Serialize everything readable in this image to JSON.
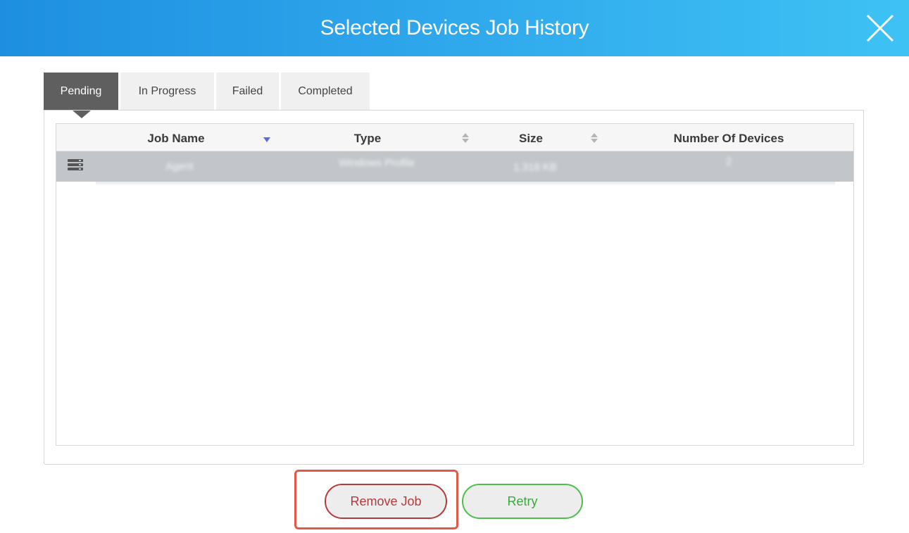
{
  "dialog": {
    "title": "Selected Devices Job History",
    "close_icon": "close-icon"
  },
  "tabs": [
    {
      "label": "Pending",
      "active": true
    },
    {
      "label": "In Progress",
      "active": false
    },
    {
      "label": "Failed",
      "active": false
    },
    {
      "label": "Completed",
      "active": false
    }
  ],
  "table": {
    "columns": [
      "Job Name",
      "Type",
      "Size",
      "Number Of Devices"
    ],
    "sort": {
      "column": "Job Name",
      "direction": "descending"
    },
    "rows": [
      {
        "icon": "server-icon",
        "job_name": "Agent",
        "type": "Windows Profile",
        "size": "1.318 KB",
        "devices": "2",
        "selected": true
      }
    ]
  },
  "actions": {
    "remove_label": "Remove Job",
    "retry_label": "Retry"
  },
  "colors": {
    "header_gradient_start": "#1e8fe0",
    "header_gradient_end": "#3ec2f4",
    "active_tab": "#5f5f5f",
    "remove": "#b23b3b",
    "retry": "#4cbf4c",
    "highlight": "#e05a4a",
    "selected_row": "#c2c6ca"
  }
}
